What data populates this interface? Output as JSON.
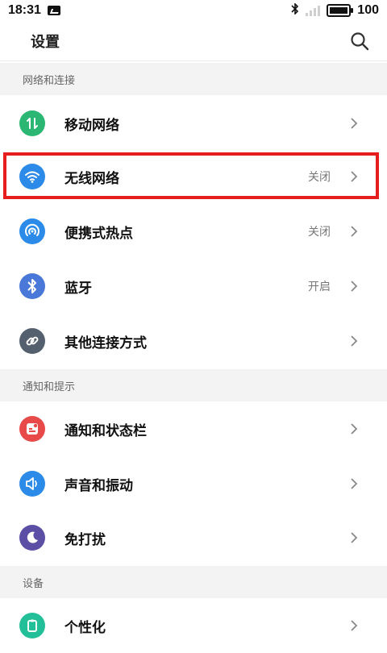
{
  "status_bar": {
    "time": "18:31",
    "battery": "100",
    "icons": [
      "message-icon",
      "bluetooth-icon",
      "signal-icon",
      "battery-icon"
    ]
  },
  "header": {
    "title": "设置",
    "search_icon": "search-icon"
  },
  "sections": [
    {
      "title": "网络和连接",
      "items": [
        {
          "label": "移动网络",
          "status": "",
          "icon": "mobile-data-icon",
          "color": "#2bb673"
        },
        {
          "label": "无线网络",
          "status": "关闭",
          "icon": "wifi-icon",
          "color": "#2c8be8"
        },
        {
          "label": "便携式热点",
          "status": "关闭",
          "icon": "hotspot-icon",
          "color": "#2c8be8"
        },
        {
          "label": "蓝牙",
          "status": "开启",
          "icon": "bluetooth-icon",
          "color": "#4a78d8"
        },
        {
          "label": "其他连接方式",
          "status": "",
          "icon": "link-icon",
          "color": "#55606e"
        }
      ]
    },
    {
      "title": "通知和提示",
      "items": [
        {
          "label": "通知和状态栏",
          "status": "",
          "icon": "notification-icon",
          "color": "#e84a4a"
        },
        {
          "label": "声音和振动",
          "status": "",
          "icon": "sound-icon",
          "color": "#2c8be8"
        },
        {
          "label": "免打扰",
          "status": "",
          "icon": "moon-icon",
          "color": "#5a4fa5"
        }
      ]
    },
    {
      "title": "设备",
      "items": [
        {
          "label": "个性化",
          "status": "",
          "icon": "personalize-icon",
          "color": "#22bf98"
        }
      ]
    }
  ]
}
